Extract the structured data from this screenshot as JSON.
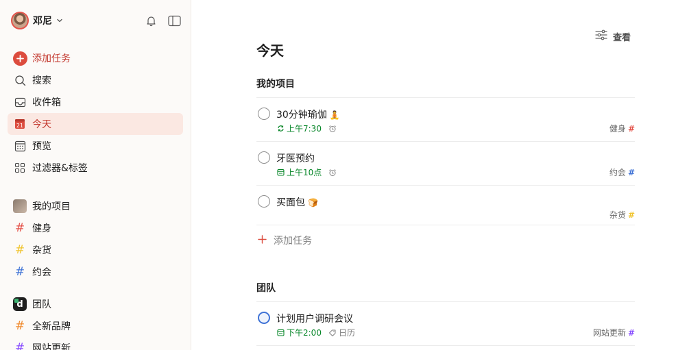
{
  "colors": {
    "accent": "#dc4c3e",
    "sidebar_bg": "#fcfaf8",
    "active_bg": "#fbe8e2",
    "date_green": "#058527",
    "tag_red": "#e4534a",
    "tag_yellow": "#f0c42f",
    "tag_blue": "#4073d6",
    "tag_purple": "#884dff"
  },
  "sidebar": {
    "user_name": "邓尼",
    "nav": {
      "add_task": "添加任务",
      "search": "搜索",
      "inbox": "收件箱",
      "today": "今天",
      "today_badge": "21",
      "upcoming": "预览",
      "filters": "过滤器&标签"
    },
    "my_projects": {
      "label": "我的项目",
      "items": [
        {
          "label": "健身",
          "color": "#e4534a"
        },
        {
          "label": "杂货",
          "color": "#f0c42f"
        },
        {
          "label": "约会",
          "color": "#4073d6"
        }
      ]
    },
    "team": {
      "label": "团队",
      "avatar_letter": "d",
      "items": [
        {
          "label": "全新品牌",
          "color": "#f08a2e"
        },
        {
          "label": "网站更新",
          "color": "#884dff"
        }
      ]
    }
  },
  "main": {
    "view_label": "查看",
    "title": "今天",
    "my_projects_section": {
      "title": "我的项目",
      "tasks": [
        {
          "name": "30分钟瑜伽",
          "emoji": "🧘",
          "date": "上午7:30",
          "project": "健身",
          "hash": "#"
        },
        {
          "name": "牙医预约",
          "date": "上午10点",
          "project": "约会",
          "hash": "#"
        },
        {
          "name": "买面包",
          "emoji": "🍞",
          "project": "杂货",
          "hash": "#"
        }
      ],
      "add_task": "添加任务"
    },
    "team_section": {
      "title": "团队",
      "tasks": [
        {
          "name": "计划用户调研会议",
          "date": "下午2:00",
          "extra": "日历",
          "project": "网站更新",
          "hash": "#"
        }
      ]
    }
  }
}
